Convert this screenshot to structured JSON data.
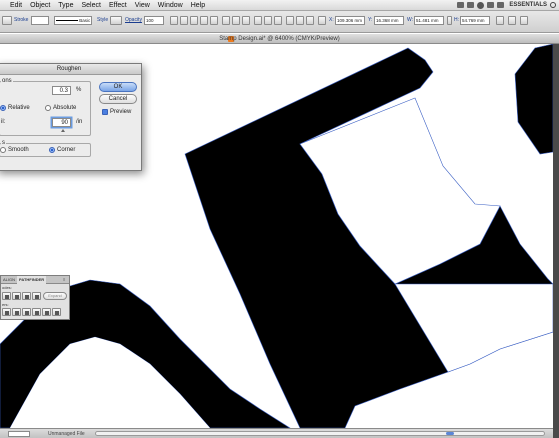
{
  "menubar": {
    "items": [
      "Edit",
      "Object",
      "Type",
      "Select",
      "Effect",
      "View",
      "Window",
      "Help"
    ],
    "workspace": "ESSENTIALS"
  },
  "controlbar": {
    "stroke_label": "Stroke",
    "brush_value": "Basic",
    "style_label": "Style",
    "opacity_label": "Opacity",
    "opacity_value": "100",
    "x_label": "X:",
    "x_value": "109.306 mm",
    "y_label": "Y:",
    "y_value": "16.368 mm",
    "w_label": "W:",
    "w_value": "51.481 mm",
    "h_label": "H:",
    "h_value": "54.769 mm"
  },
  "document": {
    "title": "Stamp Design.ai* @ 6400% (CMYK/Preview)"
  },
  "dialog": {
    "title": "Roughen",
    "options_group_label": "ons",
    "size_value": "0.3",
    "size_unit": "%",
    "relative_label": "Relative",
    "absolute_label": "Absolute",
    "detail_label": "il:",
    "detail_value": "90",
    "detail_unit": "/in",
    "points_label": "s",
    "smooth_label": "Smooth",
    "corner_label": "Corner",
    "ok_label": "OK",
    "cancel_label": "Cancel",
    "preview_label": "Preview",
    "relative_selected": true,
    "corner_selected": true,
    "preview_checked": true
  },
  "pathfinder": {
    "tab_align": "ALIGN",
    "tab_pathfinder": "PATHFINDER",
    "modes_label": "odes:",
    "expand_label": "Expand",
    "finders_label": "ers:"
  },
  "statusbar": {
    "file_status": "Unmanaged File"
  },
  "colors": {
    "accent": "#4b7fe0",
    "artwork": "#000000",
    "path_outline": "#3a5fc4"
  }
}
